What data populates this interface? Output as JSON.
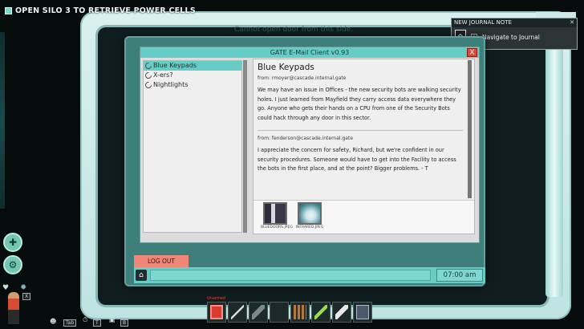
{
  "objective": {
    "text": "OPEN SILO 3 TO RETRIEVE POWER CELLS"
  },
  "hint": {
    "text": "Cannot open door from this side."
  },
  "journal": {
    "title": "NEW JOURNAL NOTE",
    "key": "J",
    "action": "Navigate to Journal",
    "icon": "journal-icon"
  },
  "email_client": {
    "title": "GATE E-Mail Client v0.93",
    "close_label": "X",
    "inbox": [
      {
        "subject": "Blue Keypads",
        "selected": true
      },
      {
        "subject": "X-ers?",
        "selected": false
      },
      {
        "subject": "Nightlights",
        "selected": false
      }
    ],
    "message": {
      "subject": "Blue Keypads",
      "entries": [
        {
          "from": "from: rmoyer@cascade.internal.gate",
          "body": "We may have an issue in Offices - the new security bots are walking security holes. I just learned from Mayfield they carry access data everywhere they go. Anyone who gets their hands on a CPU from one of the Security Bots could hack through any door in this sector."
        },
        {
          "from": "from: fenderson@cascade.internal.gate",
          "body": "I appreciate the concern for safety, Richard, but we're confident in our security procedures. Someone would have to get into the Facility to access the bots in the first place, and at the point? Bigger problems.  - T"
        }
      ]
    },
    "attachments": [
      {
        "name": "BLUEDOORS.JPEG",
        "icon": "image-thumbnail-icon"
      },
      {
        "name": "INFRARED.JPEG",
        "icon": "image-thumbnail-icon"
      }
    ],
    "logout_label": "LOG OUT",
    "start_icon": "gate-logo-icon",
    "clock": "07:00 am"
  },
  "hud": {
    "unarmed_label": "Unarmed",
    "hotkeys": [
      "X",
      "Tab",
      "T",
      "B"
    ],
    "inventory_icons": [
      "unarmed-icon",
      "knife-icon",
      "flashlight-icon",
      "empty-slot",
      "ammo-icon",
      "syringe-icon",
      "flare-icon",
      "cpu-icon"
    ],
    "colors": {
      "teal_accent": "#66cdc6",
      "logout_red": "#ee8778",
      "close_red": "#d84a3b"
    }
  }
}
